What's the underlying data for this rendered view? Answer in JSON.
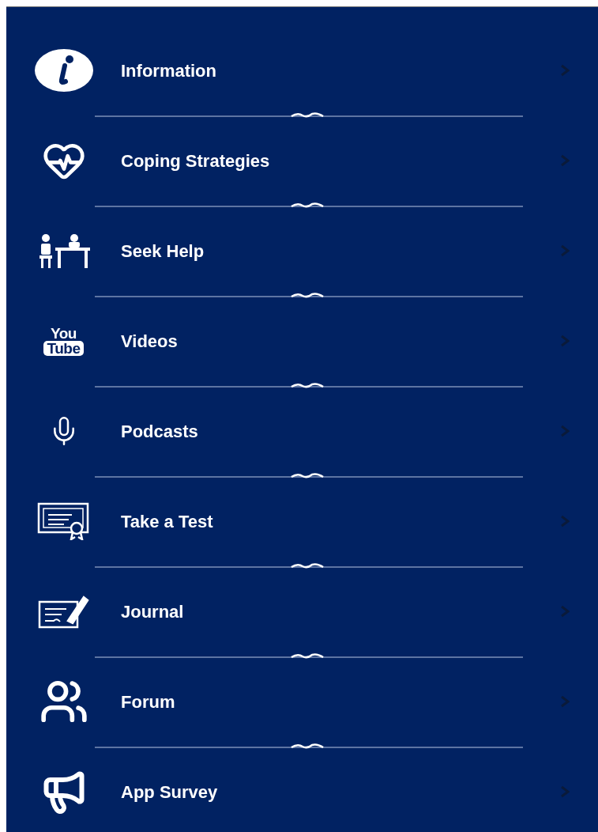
{
  "menu": {
    "items": [
      {
        "kind": "info",
        "label": "Information"
      },
      {
        "kind": "heartbeat",
        "label": "Coping Strategies"
      },
      {
        "kind": "consult",
        "label": "Seek Help"
      },
      {
        "kind": "youtube",
        "label": "Videos",
        "icon_text": [
          "You",
          "Tube"
        ]
      },
      {
        "kind": "microphone",
        "label": "Podcasts"
      },
      {
        "kind": "certificate",
        "label": "Take a Test"
      },
      {
        "kind": "journal",
        "label": "Journal"
      },
      {
        "kind": "group",
        "label": "Forum"
      },
      {
        "kind": "megaphone",
        "label": "App Survey"
      }
    ]
  }
}
